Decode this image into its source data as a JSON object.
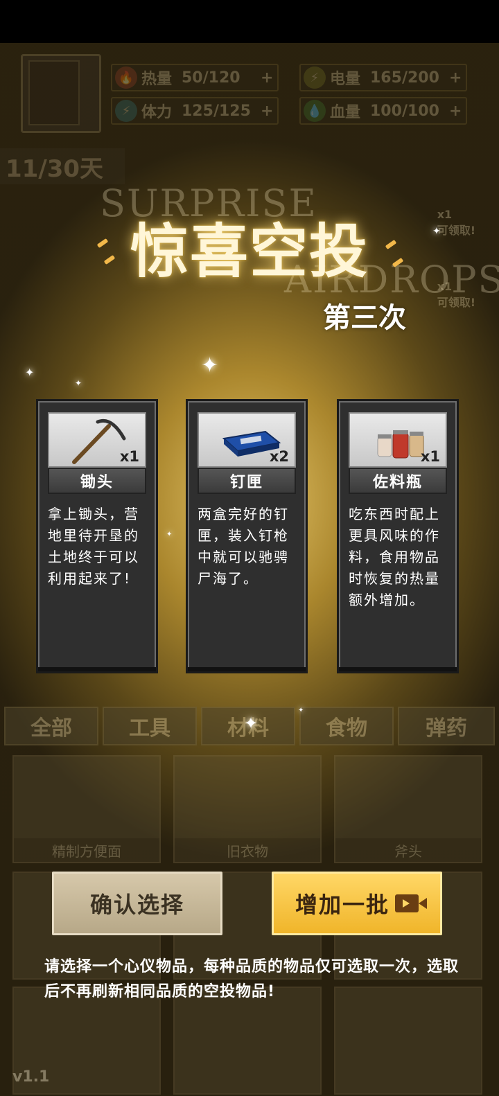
{
  "hud": {
    "stats": [
      {
        "label": "热量",
        "value": "50",
        "max": "/120",
        "plus": "+"
      },
      {
        "label": "电量",
        "value": "165",
        "max": "/200",
        "plus": "+"
      },
      {
        "label": "体力",
        "value": "125",
        "max": "/125",
        "plus": "+"
      },
      {
        "label": "血量",
        "value": "100",
        "max": "/100",
        "plus": "+"
      }
    ],
    "day": "11/30天",
    "side_items": [
      {
        "qty": "x1",
        "label": "可领取!"
      },
      {
        "qty": "x1",
        "label": "可领取!"
      }
    ]
  },
  "title": {
    "ghost_top": "SURPRISE",
    "ghost_bottom": "AIRDROPS",
    "main": "惊喜空投",
    "sub": "第三次"
  },
  "cards": [
    {
      "name": "锄头",
      "qty": "x1",
      "icon": "pickaxe-icon",
      "desc": "拿上锄头，营地里待开垦的土地终于可以利用起来了!"
    },
    {
      "name": "钉匣",
      "qty": "x2",
      "icon": "nail-box-icon",
      "desc": "两盒完好的钉匣，装入钉枪中就可以驰骋尸海了。"
    },
    {
      "name": "佐料瓶",
      "qty": "x1",
      "icon": "spice-jars-icon",
      "desc": "吃东西时配上更具风味的作料，食用物品时恢复的热量额外增加。"
    }
  ],
  "buttons": {
    "confirm": "确认选择",
    "more": "增加一批"
  },
  "notice": "请选择一个心仪物品，每种品质的物品仅可选取一次，选取后不再刷新相同品质的空投物品!",
  "tabs": [
    "全部",
    "工具",
    "材料",
    "食物",
    "弹药"
  ],
  "inventory": [
    "精制方便面",
    "旧衣物",
    "斧头"
  ],
  "version": "v1.1",
  "colors": {
    "gold": "#f0b52a",
    "card_bg": "#2f2f2f",
    "title_glow": "#ffdc78"
  }
}
